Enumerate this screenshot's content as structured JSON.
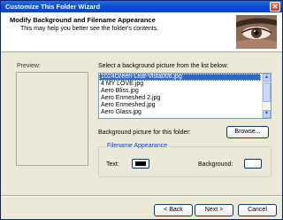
{
  "window": {
    "title": "Customize This Folder Wizard"
  },
  "header": {
    "title": "Modify Background and Filename Appearance",
    "subtitle": "This may help you better see the folder's contents."
  },
  "preview": {
    "label": "Preview:"
  },
  "picker": {
    "label": "Select a background picture from the list below:",
    "items": [
      {
        "label": "1024Green-Leaf-Vista006.jpg",
        "selected": true
      },
      {
        "label": "4 MY LOVE.jpg",
        "selected": false
      },
      {
        "label": "Aero Bliss.jpg",
        "selected": false
      },
      {
        "label": "Aero Enmeshed 2.jpg",
        "selected": false
      },
      {
        "label": "Aero Enmeshed.jpg",
        "selected": false
      },
      {
        "label": "Aero Glass.jpg",
        "selected": false
      }
    ],
    "background_label": "Background picture for this folder:",
    "browse_label": "Browse..."
  },
  "filename_appearance": {
    "title": "Filename Appearance",
    "text_label": "Text:",
    "text_color": "#000000",
    "background_label": "Background:",
    "background_color": "#ffffff"
  },
  "footer": {
    "back_label": "< Back",
    "next_label": "Next >",
    "cancel_label": "Cancel"
  },
  "colors": {
    "titlebar": "#0a4fd0",
    "selection": "#316ac5"
  }
}
